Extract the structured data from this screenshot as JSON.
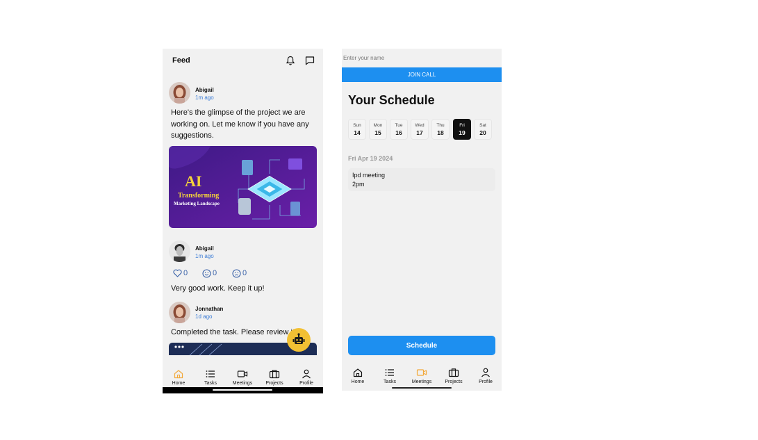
{
  "feed": {
    "title": "Feed",
    "icons": {
      "notifications": "bell-icon",
      "messages": "chat-icon"
    },
    "posts": [
      {
        "author": "Abigail",
        "time": "1m ago",
        "text_lines": [
          "Here's the glimpse of the project we are",
          "working on. Let me know if you have any",
          "suggestions."
        ],
        "banner": {
          "headline": "AI",
          "line1": "Transforming",
          "line2": "Marketing Landscape"
        }
      },
      {
        "author": "Abigail",
        "time": "1m ago",
        "reactions": [
          {
            "icon": "heart-icon",
            "count": "0"
          },
          {
            "icon": "smile-icon",
            "count": "0"
          },
          {
            "icon": "sad-icon",
            "count": "0"
          }
        ],
        "text_lines": [
          "Very good work. Keep it up!"
        ]
      },
      {
        "author": "Jonnathan",
        "time": "1d ago",
        "text_lines": [
          "Completed the task. Please review it."
        ]
      }
    ],
    "fab_icon": "robot-icon"
  },
  "nav": {
    "items": [
      {
        "label": "Home",
        "icon": "home-icon"
      },
      {
        "label": "Tasks",
        "icon": "list-icon"
      },
      {
        "label": "Meetings",
        "icon": "video-icon"
      },
      {
        "label": "Projects",
        "icon": "briefcase-icon"
      },
      {
        "label": "Profile",
        "icon": "person-icon"
      }
    ],
    "feed_active": "Home",
    "schedule_active": "Meetings",
    "active_color": "#f2a93b"
  },
  "schedule": {
    "name_placeholder": "Enter your name",
    "join_label": "JOIN CALL",
    "title": "Your Schedule",
    "days": [
      {
        "name": "Sun",
        "num": "14"
      },
      {
        "name": "Mon",
        "num": "15"
      },
      {
        "name": "Tue",
        "num": "16"
      },
      {
        "name": "Wed",
        "num": "17"
      },
      {
        "name": "Thu",
        "num": "18"
      },
      {
        "name": "Fri",
        "num": "19"
      },
      {
        "name": "Sat",
        "num": "20"
      }
    ],
    "selected_day": "Fri",
    "date_label": "Fri Apr 19 2024",
    "event": {
      "title": "Ipd meeting",
      "time": "2pm"
    },
    "button_label": "Schedule"
  },
  "colors": {
    "primary": "#1d8ff0",
    "accent": "#f2c033",
    "link": "#3a7bd5"
  }
}
